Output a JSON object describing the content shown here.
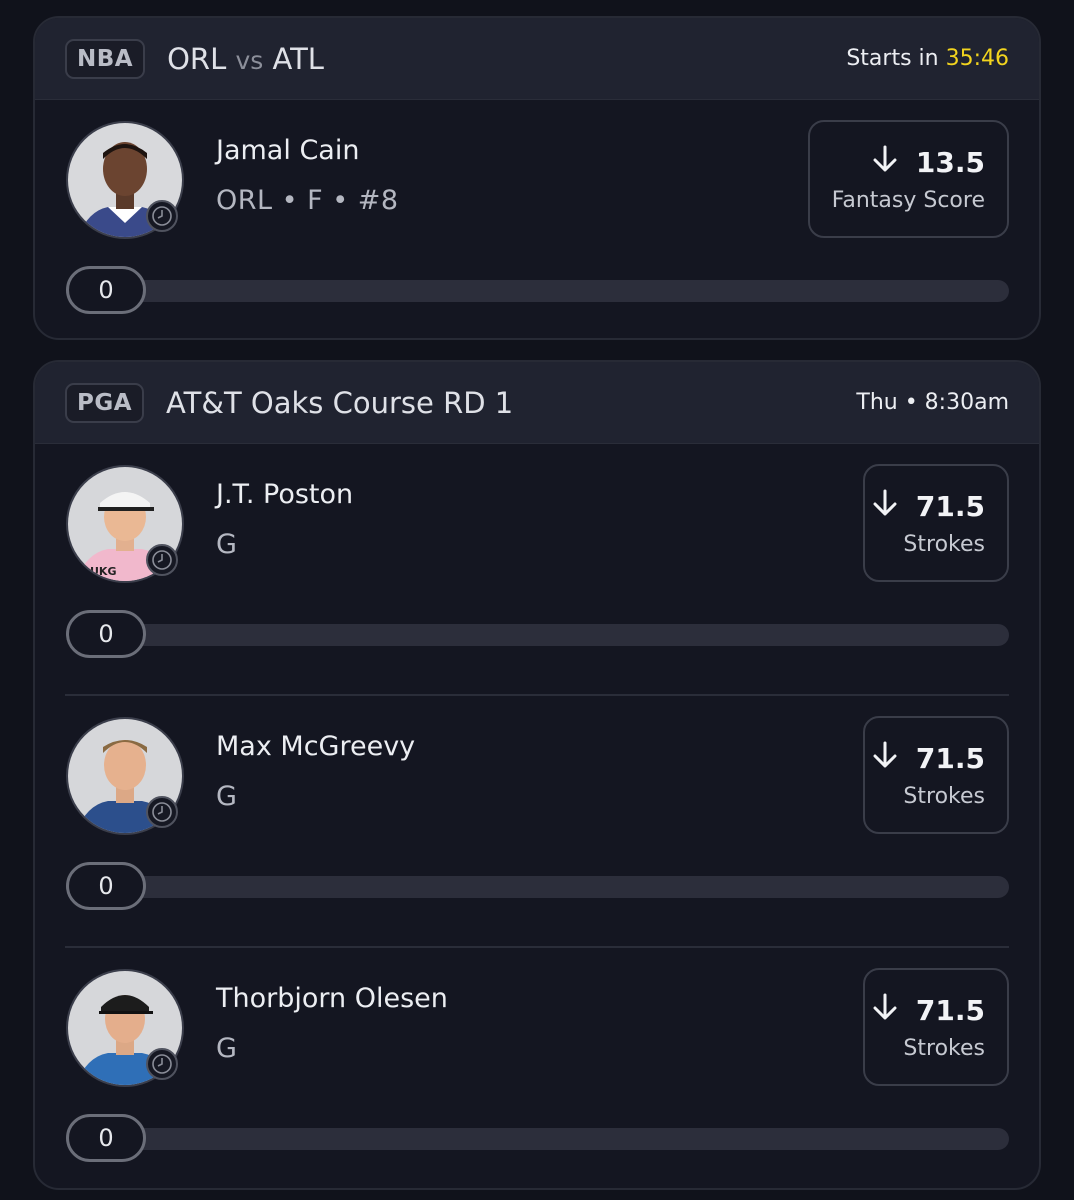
{
  "cards": [
    {
      "league": "NBA",
      "team_a": "ORL",
      "vs": "vs",
      "team_b": "ATL",
      "start_prefix": "Starts in",
      "start_timer": "35:46",
      "players": [
        {
          "name": "Jamal Cain",
          "meta": "ORL • F • #8",
          "line": "13.5",
          "stat": "Fantasy Score",
          "progress_value": "0",
          "progress_fraction": 0
        }
      ]
    },
    {
      "league": "PGA",
      "event": "AT&T Oaks Course RD 1",
      "start_time": "Thu • 8:30am",
      "players": [
        {
          "name": "J.T. Poston",
          "meta": "G",
          "line": "71.5",
          "stat": "Strokes",
          "progress_value": "0",
          "progress_fraction": 0
        },
        {
          "name": "Max McGreevy",
          "meta": "G",
          "line": "71.5",
          "stat": "Strokes",
          "progress_value": "0",
          "progress_fraction": 0
        },
        {
          "name": "Thorbjorn Olesen",
          "meta": "G",
          "line": "71.5",
          "stat": "Strokes",
          "progress_value": "0",
          "progress_fraction": 0
        }
      ]
    }
  ],
  "icons": {
    "projection_direction": "arrow-down-icon",
    "status": "clock-icon"
  },
  "colors": {
    "background": "#10121b",
    "timer": "#f2d41e",
    "card": "#141621",
    "header": "#202330"
  }
}
